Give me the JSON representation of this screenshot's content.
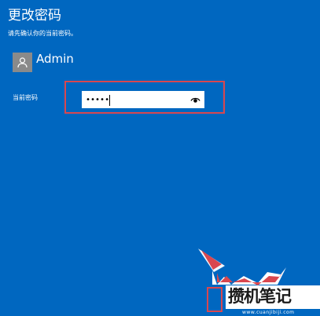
{
  "page": {
    "title": "更改密码",
    "subtitle": "请先确认你的当前密码。"
  },
  "user": {
    "name": "Admin",
    "avatar_icon": "user-icon"
  },
  "password_field": {
    "label": "当前密码",
    "value": "•••••",
    "reveal_icon": "eye-icon"
  },
  "watermark": {
    "logo_text": "攒机笔记",
    "url": "www.cuanjibiji.com"
  },
  "colors": {
    "background": "#0067c0",
    "highlight": "#d9474f",
    "avatar": "#8a8a8a"
  }
}
